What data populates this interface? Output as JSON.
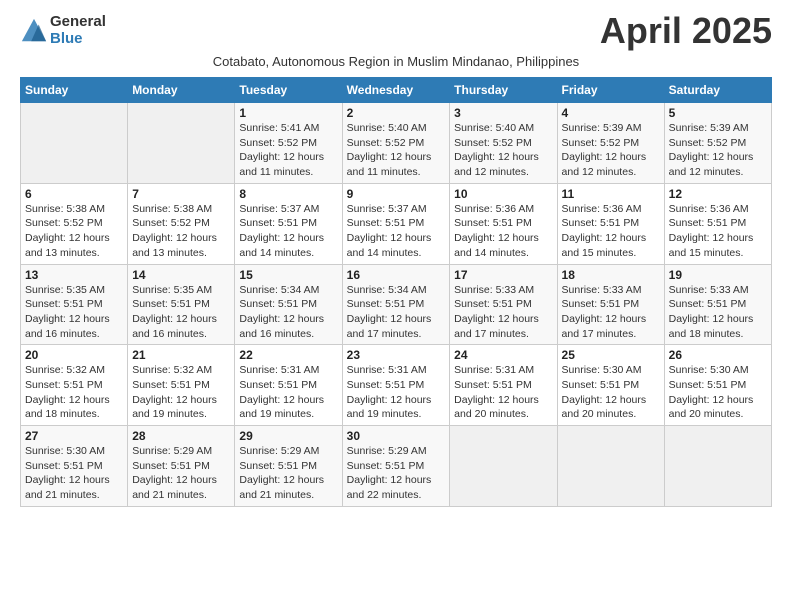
{
  "logo": {
    "general": "General",
    "blue": "Blue"
  },
  "title": "April 2025",
  "subtitle": "Cotabato, Autonomous Region in Muslim Mindanao, Philippines",
  "days_of_week": [
    "Sunday",
    "Monday",
    "Tuesday",
    "Wednesday",
    "Thursday",
    "Friday",
    "Saturday"
  ],
  "weeks": [
    [
      {
        "day": "",
        "sunrise": "",
        "sunset": "",
        "daylight": ""
      },
      {
        "day": "",
        "sunrise": "",
        "sunset": "",
        "daylight": ""
      },
      {
        "day": "1",
        "sunrise": "Sunrise: 5:41 AM",
        "sunset": "Sunset: 5:52 PM",
        "daylight": "Daylight: 12 hours and 11 minutes."
      },
      {
        "day": "2",
        "sunrise": "Sunrise: 5:40 AM",
        "sunset": "Sunset: 5:52 PM",
        "daylight": "Daylight: 12 hours and 11 minutes."
      },
      {
        "day": "3",
        "sunrise": "Sunrise: 5:40 AM",
        "sunset": "Sunset: 5:52 PM",
        "daylight": "Daylight: 12 hours and 12 minutes."
      },
      {
        "day": "4",
        "sunrise": "Sunrise: 5:39 AM",
        "sunset": "Sunset: 5:52 PM",
        "daylight": "Daylight: 12 hours and 12 minutes."
      },
      {
        "day": "5",
        "sunrise": "Sunrise: 5:39 AM",
        "sunset": "Sunset: 5:52 PM",
        "daylight": "Daylight: 12 hours and 12 minutes."
      }
    ],
    [
      {
        "day": "6",
        "sunrise": "Sunrise: 5:38 AM",
        "sunset": "Sunset: 5:52 PM",
        "daylight": "Daylight: 12 hours and 13 minutes."
      },
      {
        "day": "7",
        "sunrise": "Sunrise: 5:38 AM",
        "sunset": "Sunset: 5:52 PM",
        "daylight": "Daylight: 12 hours and 13 minutes."
      },
      {
        "day": "8",
        "sunrise": "Sunrise: 5:37 AM",
        "sunset": "Sunset: 5:51 PM",
        "daylight": "Daylight: 12 hours and 14 minutes."
      },
      {
        "day": "9",
        "sunrise": "Sunrise: 5:37 AM",
        "sunset": "Sunset: 5:51 PM",
        "daylight": "Daylight: 12 hours and 14 minutes."
      },
      {
        "day": "10",
        "sunrise": "Sunrise: 5:36 AM",
        "sunset": "Sunset: 5:51 PM",
        "daylight": "Daylight: 12 hours and 14 minutes."
      },
      {
        "day": "11",
        "sunrise": "Sunrise: 5:36 AM",
        "sunset": "Sunset: 5:51 PM",
        "daylight": "Daylight: 12 hours and 15 minutes."
      },
      {
        "day": "12",
        "sunrise": "Sunrise: 5:36 AM",
        "sunset": "Sunset: 5:51 PM",
        "daylight": "Daylight: 12 hours and 15 minutes."
      }
    ],
    [
      {
        "day": "13",
        "sunrise": "Sunrise: 5:35 AM",
        "sunset": "Sunset: 5:51 PM",
        "daylight": "Daylight: 12 hours and 16 minutes."
      },
      {
        "day": "14",
        "sunrise": "Sunrise: 5:35 AM",
        "sunset": "Sunset: 5:51 PM",
        "daylight": "Daylight: 12 hours and 16 minutes."
      },
      {
        "day": "15",
        "sunrise": "Sunrise: 5:34 AM",
        "sunset": "Sunset: 5:51 PM",
        "daylight": "Daylight: 12 hours and 16 minutes."
      },
      {
        "day": "16",
        "sunrise": "Sunrise: 5:34 AM",
        "sunset": "Sunset: 5:51 PM",
        "daylight": "Daylight: 12 hours and 17 minutes."
      },
      {
        "day": "17",
        "sunrise": "Sunrise: 5:33 AM",
        "sunset": "Sunset: 5:51 PM",
        "daylight": "Daylight: 12 hours and 17 minutes."
      },
      {
        "day": "18",
        "sunrise": "Sunrise: 5:33 AM",
        "sunset": "Sunset: 5:51 PM",
        "daylight": "Daylight: 12 hours and 17 minutes."
      },
      {
        "day": "19",
        "sunrise": "Sunrise: 5:33 AM",
        "sunset": "Sunset: 5:51 PM",
        "daylight": "Daylight: 12 hours and 18 minutes."
      }
    ],
    [
      {
        "day": "20",
        "sunrise": "Sunrise: 5:32 AM",
        "sunset": "Sunset: 5:51 PM",
        "daylight": "Daylight: 12 hours and 18 minutes."
      },
      {
        "day": "21",
        "sunrise": "Sunrise: 5:32 AM",
        "sunset": "Sunset: 5:51 PM",
        "daylight": "Daylight: 12 hours and 19 minutes."
      },
      {
        "day": "22",
        "sunrise": "Sunrise: 5:31 AM",
        "sunset": "Sunset: 5:51 PM",
        "daylight": "Daylight: 12 hours and 19 minutes."
      },
      {
        "day": "23",
        "sunrise": "Sunrise: 5:31 AM",
        "sunset": "Sunset: 5:51 PM",
        "daylight": "Daylight: 12 hours and 19 minutes."
      },
      {
        "day": "24",
        "sunrise": "Sunrise: 5:31 AM",
        "sunset": "Sunset: 5:51 PM",
        "daylight": "Daylight: 12 hours and 20 minutes."
      },
      {
        "day": "25",
        "sunrise": "Sunrise: 5:30 AM",
        "sunset": "Sunset: 5:51 PM",
        "daylight": "Daylight: 12 hours and 20 minutes."
      },
      {
        "day": "26",
        "sunrise": "Sunrise: 5:30 AM",
        "sunset": "Sunset: 5:51 PM",
        "daylight": "Daylight: 12 hours and 20 minutes."
      }
    ],
    [
      {
        "day": "27",
        "sunrise": "Sunrise: 5:30 AM",
        "sunset": "Sunset: 5:51 PM",
        "daylight": "Daylight: 12 hours and 21 minutes."
      },
      {
        "day": "28",
        "sunrise": "Sunrise: 5:29 AM",
        "sunset": "Sunset: 5:51 PM",
        "daylight": "Daylight: 12 hours and 21 minutes."
      },
      {
        "day": "29",
        "sunrise": "Sunrise: 5:29 AM",
        "sunset": "Sunset: 5:51 PM",
        "daylight": "Daylight: 12 hours and 21 minutes."
      },
      {
        "day": "30",
        "sunrise": "Sunrise: 5:29 AM",
        "sunset": "Sunset: 5:51 PM",
        "daylight": "Daylight: 12 hours and 22 minutes."
      },
      {
        "day": "",
        "sunrise": "",
        "sunset": "",
        "daylight": ""
      },
      {
        "day": "",
        "sunrise": "",
        "sunset": "",
        "daylight": ""
      },
      {
        "day": "",
        "sunrise": "",
        "sunset": "",
        "daylight": ""
      }
    ]
  ]
}
